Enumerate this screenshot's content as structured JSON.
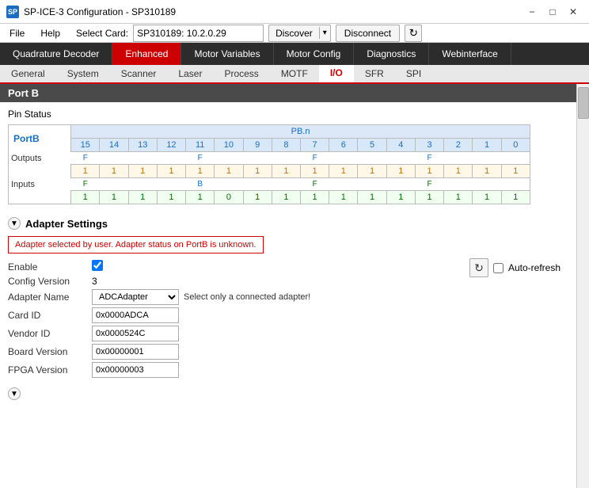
{
  "titleBar": {
    "icon": "SP",
    "title": "SP-ICE-3 Configuration - SP310189",
    "minimizeLabel": "−",
    "maximizeLabel": "□",
    "closeLabel": "✕"
  },
  "menuBar": {
    "fileLabel": "File",
    "helpLabel": "Help",
    "selectCardLabel": "Select Card:",
    "cardValue": "SP310189: 10.2.0.29",
    "discoverLabel": "Discover",
    "discoverArrow": "▾",
    "disconnectLabel": "Disconnect",
    "refreshIcon": "↻"
  },
  "navTabs1": [
    {
      "label": "Quadrature Decoder",
      "active": false
    },
    {
      "label": "Enhanced",
      "active": false
    },
    {
      "label": "Motor Variables",
      "active": false
    },
    {
      "label": "Motor Config",
      "active": false
    },
    {
      "label": "Diagnostics",
      "active": false
    },
    {
      "label": "Webinterface",
      "active": false
    }
  ],
  "navTabs2": [
    {
      "label": "General",
      "active": false
    },
    {
      "label": "System",
      "active": false
    },
    {
      "label": "Scanner",
      "active": false
    },
    {
      "label": "Laser",
      "active": false
    },
    {
      "label": "Process",
      "active": false
    },
    {
      "label": "MOTF",
      "active": false
    },
    {
      "label": "I/O",
      "active": true
    },
    {
      "label": "SFR",
      "active": false
    },
    {
      "label": "SPI",
      "active": false
    }
  ],
  "sectionHeader": "Port B",
  "pinStatus": {
    "title": "Pin Status",
    "portBLabel": "PortB",
    "pbnLabel": "PB.n",
    "pinNumbers": [
      15,
      14,
      13,
      12,
      11,
      10,
      9,
      8,
      7,
      6,
      5,
      4,
      3,
      2,
      1,
      0
    ],
    "outputsLabel": "Outputs",
    "inputsLabel": "Inputs",
    "outputFlags": [
      "F",
      "",
      "",
      "",
      "F",
      "",
      "",
      "",
      "F",
      "",
      "",
      "",
      "F",
      "",
      "",
      ""
    ],
    "inputFlags": [
      "F",
      "",
      "",
      "",
      "B",
      "",
      "",
      "",
      "F",
      "",
      "",
      "",
      "F",
      "",
      "",
      ""
    ],
    "outputValues": [
      1,
      1,
      1,
      1,
      1,
      1,
      1,
      1,
      1,
      1,
      1,
      1,
      1,
      1,
      1,
      1
    ],
    "inputValues": [
      1,
      1,
      1,
      1,
      1,
      0,
      1,
      1,
      1,
      1,
      1,
      1,
      1,
      1,
      1,
      1
    ]
  },
  "autoRefresh": {
    "refreshIcon": "↻",
    "label": "Auto-refresh"
  },
  "adapterSettings": {
    "collapseIcon": "▼",
    "title": "Adapter Settings",
    "warningText": "Adapter selected by user. Adapter status on PortB is unknown.",
    "enableLabel": "Enable",
    "enableChecked": true,
    "configVersionLabel": "Config Version",
    "configVersionValue": "3",
    "adapterNameLabel": "Adapter Name",
    "adapterNameValue": "ADCAdapter",
    "adapterArrow": "▾",
    "adapterNote": "Select only a connected adapter!",
    "cardIdLabel": "Card ID",
    "cardIdValue": "0x0000ADCA",
    "vendorIdLabel": "Vendor ID",
    "vendorIdValue": "0x0000524C",
    "boardVersionLabel": "Board Version",
    "boardVersionValue": "0x00000001",
    "fpgaVersionLabel": "FPGA Version",
    "fpgaVersionValue": "0x00000003"
  }
}
